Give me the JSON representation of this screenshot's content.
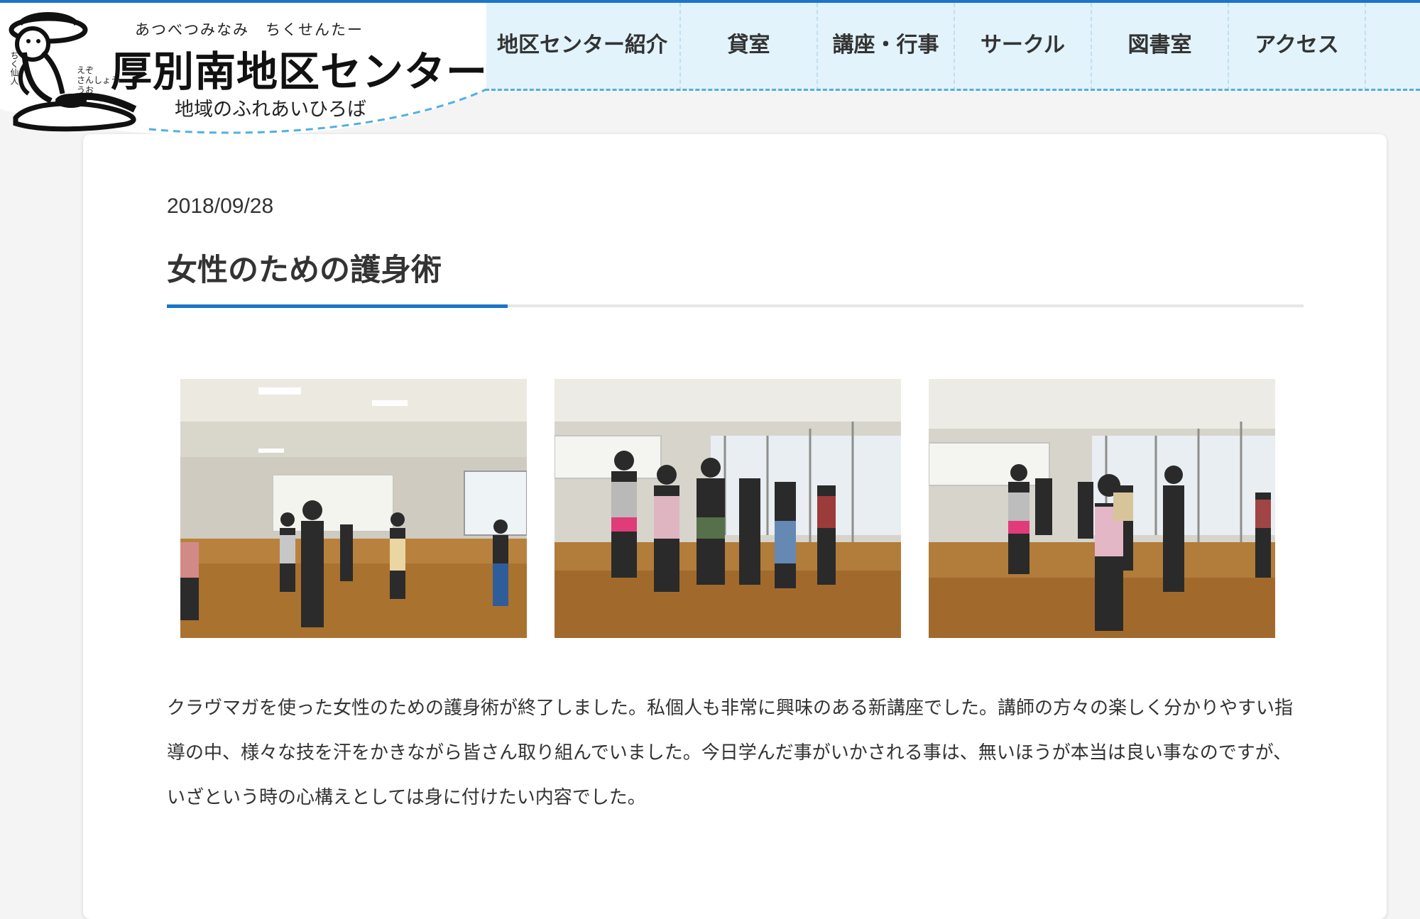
{
  "site": {
    "name": "厚別南地区センター",
    "ruby": "あつべつみなみ　ちくせんたー",
    "tagline": "地域のふれあいひろば",
    "mascot_label": "ちく仙人",
    "mascot_sub": "えぞ\nさんしょう\nうお",
    "mascot_icon": "sage-mascot-icon",
    "accent_color": "#1b75c9",
    "nav_bg": "#e2f3fb"
  },
  "nav": {
    "items": [
      {
        "label": "地区センター紹介"
      },
      {
        "label": "貸室"
      },
      {
        "label": "講座・行事"
      },
      {
        "label": "サークル"
      },
      {
        "label": "図書室"
      },
      {
        "label": "アクセス"
      }
    ]
  },
  "post": {
    "date": "2018/09/28",
    "title": "女性のための護身術",
    "photos": [
      {
        "name": "workshop-photo-1"
      },
      {
        "name": "workshop-photo-2"
      },
      {
        "name": "workshop-photo-3"
      }
    ],
    "body": "クラヴマガを使った女性のための護身術が終了しました。私個人も非常に興味のある新講座でした。講師の方々の楽しく分かりやすい指導の中、様々な技を汗をかきながら皆さん取り組んでいました。今日学んだ事がいかされる事は、無いほうが本当は良い事なのですが、いざという時の心構えとしては身に付けたい内容でした。"
  }
}
